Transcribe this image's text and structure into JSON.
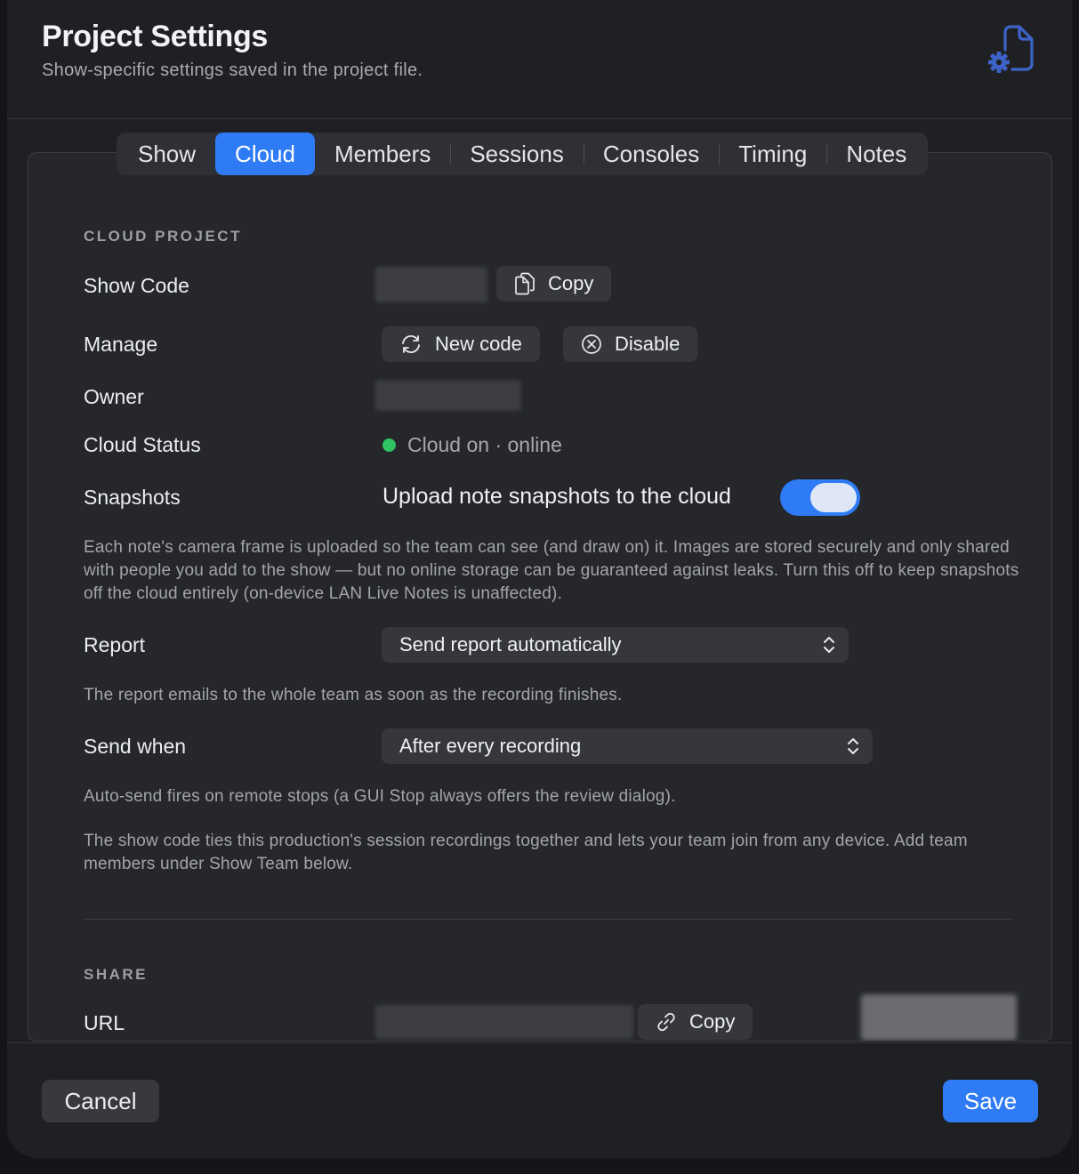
{
  "header": {
    "title": "Project Settings",
    "subtitle": "Show-specific settings saved in the project file.",
    "icon": "document-gear-icon"
  },
  "tabs": [
    {
      "label": "Show",
      "active": false
    },
    {
      "label": "Cloud",
      "active": true
    },
    {
      "label": "Members",
      "active": false
    },
    {
      "label": "Sessions",
      "active": false
    },
    {
      "label": "Consoles",
      "active": false
    },
    {
      "label": "Timing",
      "active": false
    },
    {
      "label": "Notes",
      "active": false
    }
  ],
  "cloud": {
    "section_label": "CLOUD PROJECT",
    "show_code_label": "Show Code",
    "copy_label": "Copy",
    "manage_label": "Manage",
    "new_code_label": "New code",
    "disable_label": "Disable",
    "owner_label": "Owner",
    "cloud_status_label": "Cloud Status",
    "cloud_status_value": "Cloud on · online",
    "snapshots_label": "Snapshots",
    "snapshots_toggle_label": "Upload note snapshots to the cloud",
    "snapshots_enabled": true,
    "snapshots_help": "Each note's camera frame is uploaded so the team can see (and draw on) it. Images are stored securely and only shared with people you add to the show — but no online storage can be guaranteed against leaks. Turn this off to keep snapshots off the cloud entirely (on-device LAN Live Notes is unaffected).",
    "report_label": "Report",
    "report_value": "Send report automatically",
    "report_help": "The report emails to the whole team as soon as the recording finishes.",
    "send_when_label": "Send when",
    "send_when_value": "After every recording",
    "send_when_help": "Auto-send fires on remote stops (a GUI Stop always offers the review dialog).",
    "show_code_help": "The show code ties this production's session recordings together and lets your team join from any device. Add team members under Show Team below."
  },
  "share": {
    "section_label": "SHARE",
    "url_label": "URL",
    "copy_label": "Copy"
  },
  "footer": {
    "cancel_label": "Cancel",
    "save_label": "Save"
  },
  "colors": {
    "accent": "#2f7bf5",
    "status_online": "#2fc463",
    "icon_blue": "#3d63c9"
  }
}
